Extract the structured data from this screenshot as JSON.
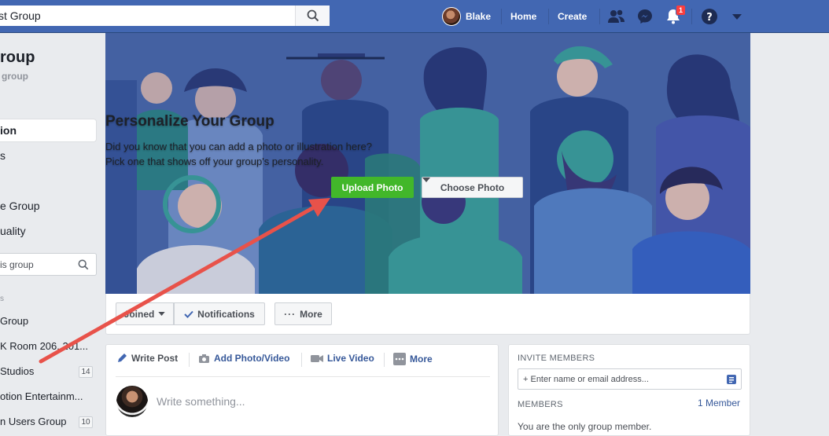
{
  "topbar": {
    "search_value": "st Group",
    "user_name": "Blake",
    "nav_home": "Home",
    "nav_create": "Create",
    "notification_count": "1"
  },
  "sidebar": {
    "group_title": "roup",
    "group_sub": "group",
    "items": [
      {
        "label": "ion"
      },
      {
        "label": "s"
      },
      {
        "label": "e Group"
      },
      {
        "label": "uality"
      }
    ],
    "search_placeholder": "is group",
    "section_header": "s",
    "groups": [
      {
        "label": "Group",
        "count": ""
      },
      {
        "label": "K Room 206, 201...",
        "count": ""
      },
      {
        "label": "Studios",
        "count": "14"
      },
      {
        "label": "otion Entertainm...",
        "count": ""
      },
      {
        "label": "n Users Group",
        "count": "10"
      }
    ]
  },
  "cover": {
    "heading": "Personalize Your Group",
    "line1": "Did you know that you can add a photo or illustration here?",
    "line2": "Pick one that shows off your group's personality.",
    "upload_label": "Upload Photo",
    "choose_label": "Choose Photo"
  },
  "actionbar": {
    "joined_label": "Joined",
    "notifications_label": "Notifications",
    "more_label": "More"
  },
  "composer": {
    "tabs": [
      "Write Post",
      "Add Photo/Video",
      "Live Video",
      "More"
    ],
    "placeholder": "Write something..."
  },
  "rightpanel": {
    "invite_header": "INVITE MEMBERS",
    "invite_placeholder": "+ Enter name or email address...",
    "members_header": "MEMBERS",
    "members_count": "1 Member",
    "members_text": "You are the only group member."
  },
  "colors": {
    "topbar": "#4267b2",
    "upload_green": "#42b72a",
    "annotation_arrow": "#e8524a"
  }
}
